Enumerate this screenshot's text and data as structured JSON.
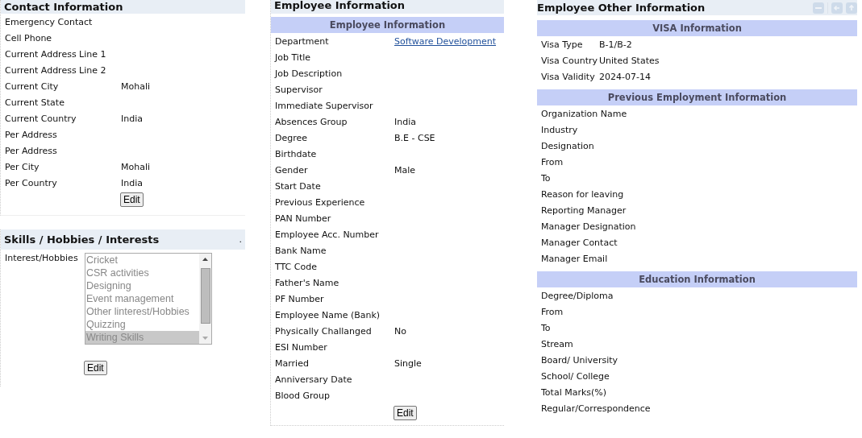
{
  "contact": {
    "title": "Contact Information",
    "rows": [
      {
        "label": "Emergency Contact",
        "value": ""
      },
      {
        "label": "Cell Phone",
        "value": ""
      },
      {
        "label": "Current Address Line 1",
        "value": ""
      },
      {
        "label": "Current Address Line 2",
        "value": ""
      },
      {
        "label": "Current City",
        "value": "Mohali"
      },
      {
        "label": "Current State",
        "value": ""
      },
      {
        "label": "Current Country",
        "value": "India"
      },
      {
        "label": "Per Address",
        "value": ""
      },
      {
        "label": "Per Address",
        "value": ""
      },
      {
        "label": "Per City",
        "value": "Mohali"
      },
      {
        "label": "Per Country",
        "value": "India"
      }
    ],
    "edit_button": "Edit"
  },
  "skills": {
    "title": "Skills / Hobbies / Interests",
    "title_mark": ".",
    "field_label": "Interest/Hobbies",
    "options": [
      {
        "label": "Cricket",
        "selected": false
      },
      {
        "label": "CSR activities",
        "selected": false
      },
      {
        "label": "Designing",
        "selected": false
      },
      {
        "label": "Event management",
        "selected": false
      },
      {
        "label": "Other linterest/Hobbies",
        "selected": false
      },
      {
        "label": "Quizzing",
        "selected": false
      },
      {
        "label": "Writing Skills",
        "selected": true
      }
    ],
    "edit_button": "Edit"
  },
  "employee": {
    "title": "Employee Information",
    "subtitle": "Employee Information",
    "rows": [
      {
        "label": "Department",
        "value": "Software Development",
        "kind": "link"
      },
      {
        "label": "Job Title",
        "value": "",
        "kind": "text"
      },
      {
        "label": "Job Description",
        "value": "",
        "kind": "text"
      },
      {
        "label": "Supervisor",
        "value": "",
        "kind": "text"
      },
      {
        "label": "Immediate Supervisor",
        "value": "",
        "kind": "text"
      },
      {
        "label": "Absences Group",
        "value": "India",
        "kind": "text"
      },
      {
        "label": "Degree",
        "value": "B.E - CSE",
        "kind": "text"
      },
      {
        "label": "Birthdate",
        "value": "",
        "kind": "text"
      },
      {
        "label": "Gender",
        "value": "Male",
        "kind": "text"
      },
      {
        "label": "Start Date",
        "value": "",
        "kind": "text"
      },
      {
        "label": "Previous Experience",
        "value": "",
        "kind": "text"
      },
      {
        "label": "PAN Number",
        "value": "",
        "kind": "text"
      },
      {
        "label": "Employee Acc. Number",
        "value": "",
        "kind": "text"
      },
      {
        "label": "Bank Name",
        "value": "",
        "kind": "text"
      },
      {
        "label": "TTC Code",
        "value": "",
        "kind": "text"
      },
      {
        "label": "Father's Name",
        "value": "",
        "kind": "text"
      },
      {
        "label": "PF Number",
        "value": "",
        "kind": "text"
      },
      {
        "label": "Employee Name (Bank)",
        "value": "",
        "kind": "text"
      },
      {
        "label": "Physically Challanged",
        "value": "No",
        "kind": "text"
      },
      {
        "label": "ESI Number",
        "value": "",
        "kind": "text"
      },
      {
        "label": "Married",
        "value": "Single",
        "kind": "text"
      },
      {
        "label": "Anniversary Date",
        "value": "",
        "kind": "text"
      },
      {
        "label": "Blood Group",
        "value": "",
        "kind": "text"
      }
    ],
    "edit_button": "Edit"
  },
  "other": {
    "title": "Employee Other Information",
    "sections": [
      {
        "title": "VISA Information",
        "rows": [
          {
            "label": "Visa Type",
            "value": "B-1/B-2"
          },
          {
            "label": "Visa Country",
            "value": "United States"
          },
          {
            "label": "Visa Validity",
            "value": "2024-07-14"
          }
        ]
      },
      {
        "title": "Previous Employment Information",
        "rows": [
          {
            "label": "Organization Name",
            "value": ""
          },
          {
            "label": "Industry",
            "value": ""
          },
          {
            "label": "Designation",
            "value": ""
          },
          {
            "label": "From",
            "value": ""
          },
          {
            "label": "To",
            "value": ""
          },
          {
            "label": "Reason for leaving",
            "value": ""
          },
          {
            "label": "Reporting Manager",
            "value": ""
          },
          {
            "label": "Manager Designation",
            "value": ""
          },
          {
            "label": "Manager Contact",
            "value": ""
          },
          {
            "label": "Manager Email",
            "value": ""
          }
        ]
      },
      {
        "title": "Education Information",
        "rows": [
          {
            "label": "Degree/Diploma",
            "value": ""
          },
          {
            "label": "From",
            "value": ""
          },
          {
            "label": "To",
            "value": ""
          },
          {
            "label": "Stream",
            "value": ""
          },
          {
            "label": "Board/ University",
            "value": ""
          },
          {
            "label": "School/ College",
            "value": ""
          },
          {
            "label": "Total Marks(%)",
            "value": ""
          },
          {
            "label": "Regular/Correspondence",
            "value": ""
          }
        ]
      }
    ]
  }
}
